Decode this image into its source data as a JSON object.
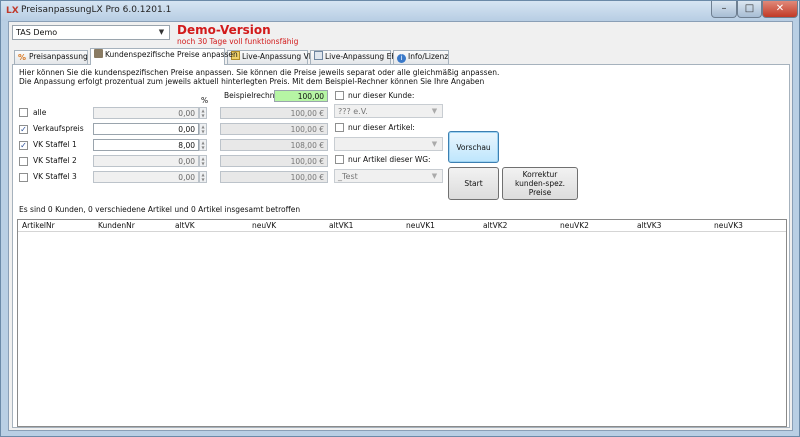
{
  "window": {
    "title": "PreisanpassungLX Pro 6.0.1201.1",
    "app_icon": "LX",
    "controls": [
      "minimize-icon",
      "maximize-icon",
      "close-icon"
    ]
  },
  "top": {
    "company_select": "TAS Demo",
    "demo_title": "Demo-Version",
    "demo_subtitle": "noch 30 Tage voll funktionsfähig"
  },
  "tabs": [
    {
      "label": "Preisanpassung",
      "icon": "percent-icon",
      "active": false
    },
    {
      "label": "Kundenspezifische Preise anpassen",
      "icon": "customer-icon",
      "active": true
    },
    {
      "label": "Live-Anpassung VK",
      "icon": "live-vk-icon",
      "active": false
    },
    {
      "label": "Live-Anpassung EK",
      "icon": "table-icon",
      "active": false
    },
    {
      "label": "Info/Lizenz",
      "icon": "info-icon",
      "active": false
    }
  ],
  "info_lines": [
    "Hier können Sie die kundenspezifischen Preise anpassen. Sie können die Preise jeweils separat oder alle gleichmäßig anpassen.",
    "Die Anpassung erfolgt prozentual zum jeweils aktuell hinterlegten Preis. Mit dem Beispiel-Rechner können Sie Ihre Angaben"
  ],
  "percent_header": "%",
  "example_label": "Beispielrechnung",
  "example_value": "100,00",
  "rows": [
    {
      "label": "alle",
      "checked": false,
      "percent": "0,00",
      "example": "100,00 €"
    },
    {
      "label": "Verkaufspreis",
      "checked": true,
      "percent": "0,00",
      "example": "100,00 €"
    },
    {
      "label": "VK Staffel 1",
      "checked": true,
      "percent": "8,00",
      "example": "108,00 €"
    },
    {
      "label": "VK Staffel 2",
      "checked": false,
      "percent": "0,00",
      "example": "100,00 €"
    },
    {
      "label": "VK Staffel 3",
      "checked": false,
      "percent": "0,00",
      "example": "100,00 €"
    }
  ],
  "filters": {
    "customer_label": "nur dieser Kunde:",
    "customer_value": "??? e.V.",
    "article_label": "nur dieser Artikel:",
    "article_value": "",
    "group_label": "nur Artikel dieser WG:",
    "group_value": "_Test"
  },
  "buttons": {
    "preview": "Vorschau",
    "start": "Start",
    "correction": "Korrektur kunden-spez. Preise"
  },
  "status": "Es sind 0 Kunden, 0 verschiedene Artikel und 0 Artikel insgesamt betroffen",
  "grid_columns": [
    "ArtikelNr",
    "KundenNr",
    "altVK",
    "neuVK",
    "altVK1",
    "neuVK1",
    "altVK2",
    "neuVK2",
    "altVK3",
    "neuVK3"
  ],
  "colors": {
    "demo": "#d21a1a",
    "highlight_green": "#b6f5a4",
    "window_frame": "#b9cfe4"
  }
}
